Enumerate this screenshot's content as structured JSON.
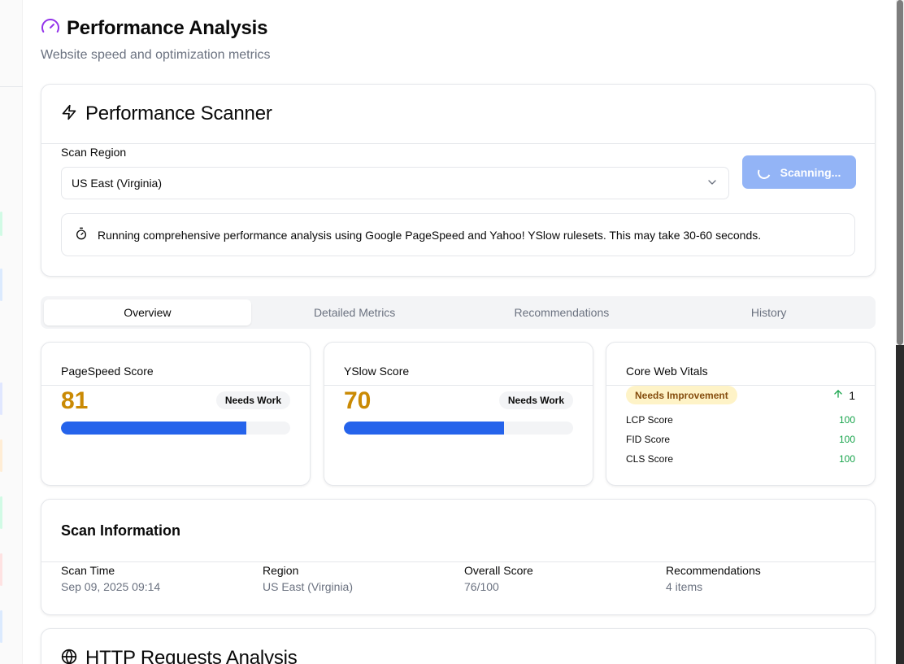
{
  "page": {
    "title": "Performance Analysis",
    "subtitle": "Website speed and optimization metrics",
    "title_icon": "gauge-icon"
  },
  "scanner": {
    "title": "Performance Scanner",
    "title_icon": "lightning-icon",
    "region_label": "Scan Region",
    "region_value": "US East (Virginia)",
    "button_label": "Scanning...",
    "button_state": "loading",
    "notice_icon": "stopwatch-icon",
    "notice": "Running comprehensive performance analysis using Google PageSpeed and Yahoo! YSlow rulesets. This may take 30-60 seconds."
  },
  "tabs": [
    {
      "label": "Overview",
      "active": true
    },
    {
      "label": "Detailed Metrics",
      "active": false
    },
    {
      "label": "Recommendations",
      "active": false
    },
    {
      "label": "History",
      "active": false
    }
  ],
  "pagespeed": {
    "title": "PageSpeed Score",
    "score": "81",
    "badge": "Needs Work",
    "progress_percent": 81
  },
  "yslow": {
    "title": "YSlow Score",
    "score": "70",
    "badge": "Needs Work",
    "progress_percent": 70
  },
  "core_web_vitals": {
    "title": "Core Web Vitals",
    "status": "Needs Improvement",
    "trend_icon": "arrow-up-icon",
    "trend_value": "1",
    "metrics": [
      {
        "label": "LCP Score",
        "value": "100"
      },
      {
        "label": "FID Score",
        "value": "100"
      },
      {
        "label": "CLS Score",
        "value": "100"
      }
    ]
  },
  "scan_info": {
    "title": "Scan Information",
    "fields": [
      {
        "label": "Scan Time",
        "value": "Sep 09, 2025 09:14"
      },
      {
        "label": "Region",
        "value": "US East (Virginia)"
      },
      {
        "label": "Overall Score",
        "value": "76/100"
      },
      {
        "label": "Recommendations",
        "value": "4 items"
      }
    ]
  },
  "http_requests": {
    "title": "HTTP Requests Analysis",
    "title_icon": "globe-icon"
  },
  "colors": {
    "score_amber": "#ca8a04",
    "progress_blue": "#2563eb",
    "button_disabled_blue": "#93b4f6",
    "good_green": "#16a34a",
    "warning_bg": "#fef3c7",
    "title_icon_purple": "#9333ea"
  }
}
